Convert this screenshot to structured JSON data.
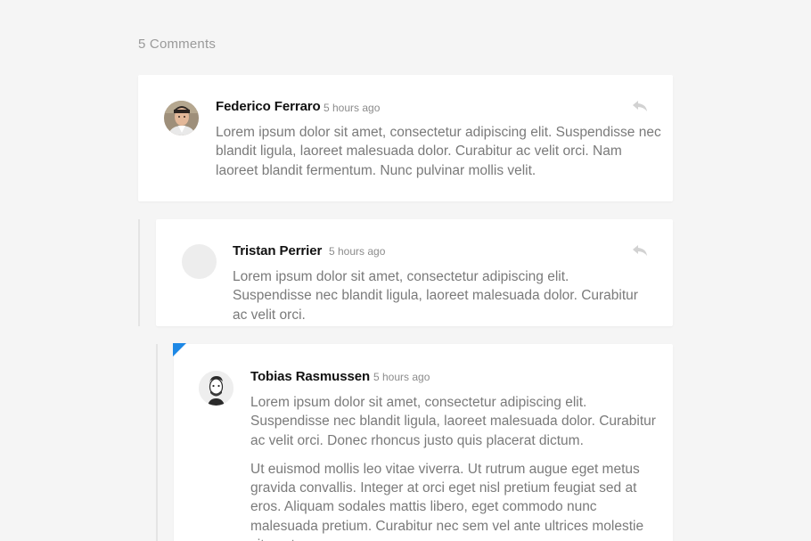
{
  "header": {
    "comments_count": "5 Comments"
  },
  "comments": [
    {
      "author": "Federico Ferraro",
      "time": "5 hours ago",
      "paragraphs": [
        "Lorem ipsum dolor sit amet, consectetur adipiscing elit. Suspendisse nec blandit ligula, laoreet malesuada dolor. Curabitur ac velit orci. Nam laoreet blandit fermentum. Nunc pulvinar mollis velit."
      ],
      "avatar": "photo-avatar",
      "actions": {
        "reply": "reply-icon"
      }
    },
    {
      "author": "Tristan Perrier",
      "time": "5 hours ago",
      "paragraphs": [
        "Lorem ipsum dolor sit amet, consectetur adipiscing elit. Suspendisse nec blandit ligula, laoreet malesuada dolor. Curabitur ac velit orci."
      ],
      "avatar": "placeholder-avatar",
      "actions": {
        "reply": "reply-icon"
      }
    },
    {
      "author": "Tobias Rasmussen",
      "time": "5 hours ago",
      "paragraphs": [
        "Lorem ipsum dolor sit amet, consectetur adipiscing elit. Suspendisse nec blandit ligula, laoreet malesuada dolor. Curabitur ac velit orci. Donec rhoncus justo quis placerat dictum.",
        "Ut euismod mollis leo vitae viverra. Ut rutrum augue eget metus gravida convallis. Integer at orci eget nisl pretium feugiat sed at eros. Aliquam sodales mattis libero, eget commodo nunc malesuada pretium. Curabitur nec sem vel ante ultrices molestie vitae at quam."
      ],
      "avatar": "illustrated-avatar",
      "highlighted": true
    }
  ],
  "colors": {
    "background": "#f5f5f5",
    "card": "#ffffff",
    "accent": "#1e88e5",
    "author": "#111111",
    "body_text": "#7a7a7a",
    "meta_text": "#8c8c8c",
    "thread_line": "#e4e4e4"
  }
}
